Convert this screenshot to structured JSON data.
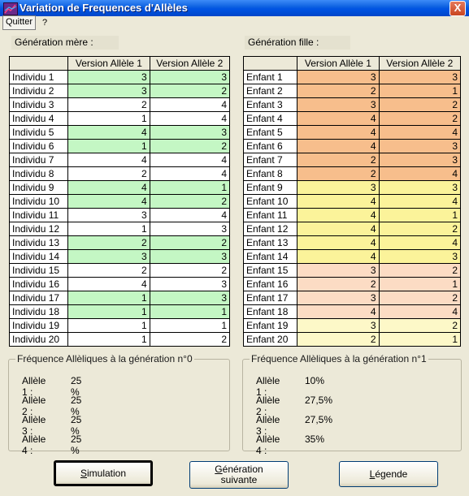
{
  "window": {
    "title": "Variation de Frequences d'Allèles",
    "close_glyph": "X"
  },
  "menu": {
    "quit_label": "Quitter",
    "help_label": "?"
  },
  "parents": {
    "label": "Génération mère :",
    "col1": "Version Allèle 1",
    "col2": "Version Allèle 2",
    "rows": [
      {
        "name": "Individu 1",
        "a1": "3",
        "a2": "3",
        "hl": true
      },
      {
        "name": "Individu 2",
        "a1": "3",
        "a2": "2",
        "hl": true
      },
      {
        "name": "Individu 3",
        "a1": "2",
        "a2": "4",
        "hl": false
      },
      {
        "name": "Individu 4",
        "a1": "1",
        "a2": "4",
        "hl": false
      },
      {
        "name": "Individu 5",
        "a1": "4",
        "a2": "3",
        "hl": true
      },
      {
        "name": "Individu 6",
        "a1": "1",
        "a2": "2",
        "hl": true
      },
      {
        "name": "Individu 7",
        "a1": "4",
        "a2": "4",
        "hl": false
      },
      {
        "name": "Individu 8",
        "a1": "2",
        "a2": "4",
        "hl": false
      },
      {
        "name": "Individu 9",
        "a1": "4",
        "a2": "1",
        "hl": true
      },
      {
        "name": "Individu 10",
        "a1": "4",
        "a2": "2",
        "hl": true
      },
      {
        "name": "Individu 11",
        "a1": "3",
        "a2": "4",
        "hl": false
      },
      {
        "name": "Individu 12",
        "a1": "1",
        "a2": "3",
        "hl": false
      },
      {
        "name": "Individu 13",
        "a1": "2",
        "a2": "2",
        "hl": true
      },
      {
        "name": "Individu 14",
        "a1": "3",
        "a2": "3",
        "hl": true
      },
      {
        "name": "Individu 15",
        "a1": "2",
        "a2": "2",
        "hl": false
      },
      {
        "name": "Individu 16",
        "a1": "4",
        "a2": "3",
        "hl": false
      },
      {
        "name": "Individu 17",
        "a1": "1",
        "a2": "3",
        "hl": true
      },
      {
        "name": "Individu 18",
        "a1": "1",
        "a2": "1",
        "hl": true
      },
      {
        "name": "Individu 19",
        "a1": "1",
        "a2": "1",
        "hl": false
      },
      {
        "name": "Individu 20",
        "a1": "1",
        "a2": "2",
        "hl": false
      }
    ]
  },
  "children": {
    "label": "Génération fille :",
    "col1": "Version Allèle 1",
    "col2": "Version Allèle 2",
    "rows": [
      {
        "name": "Enfant  1",
        "a1": "3",
        "a2": "3",
        "color": "#f7be8c"
      },
      {
        "name": "Enfant  2",
        "a1": "2",
        "a2": "1",
        "color": "#f7be8c"
      },
      {
        "name": "Enfant  3",
        "a1": "3",
        "a2": "2",
        "color": "#f7be8c"
      },
      {
        "name": "Enfant  4",
        "a1": "4",
        "a2": "2",
        "color": "#f7be8c"
      },
      {
        "name": "Enfant  5",
        "a1": "4",
        "a2": "4",
        "color": "#f7be8c"
      },
      {
        "name": "Enfant  6",
        "a1": "4",
        "a2": "3",
        "color": "#f7be8c"
      },
      {
        "name": "Enfant  7",
        "a1": "2",
        "a2": "3",
        "color": "#f7be8c"
      },
      {
        "name": "Enfant  8",
        "a1": "2",
        "a2": "4",
        "color": "#f7be8c"
      },
      {
        "name": "Enfant  9",
        "a1": "3",
        "a2": "3",
        "color": "#fbf39a"
      },
      {
        "name": "Enfant  10",
        "a1": "4",
        "a2": "4",
        "color": "#fbf39a"
      },
      {
        "name": "Enfant  11",
        "a1": "4",
        "a2": "1",
        "color": "#fbf39a"
      },
      {
        "name": "Enfant  12",
        "a1": "4",
        "a2": "2",
        "color": "#fbf39a"
      },
      {
        "name": "Enfant  13",
        "a1": "4",
        "a2": "4",
        "color": "#fbf39a"
      },
      {
        "name": "Enfant  14",
        "a1": "4",
        "a2": "3",
        "color": "#fbf39a"
      },
      {
        "name": "Enfant  15",
        "a1": "3",
        "a2": "2",
        "color": "#fcdcc4"
      },
      {
        "name": "Enfant  16",
        "a1": "2",
        "a2": "1",
        "color": "#fcdcc4"
      },
      {
        "name": "Enfant  17",
        "a1": "3",
        "a2": "2",
        "color": "#fcdcc4"
      },
      {
        "name": "Enfant  18",
        "a1": "4",
        "a2": "4",
        "color": "#fcdcc4"
      },
      {
        "name": "Enfant  19",
        "a1": "3",
        "a2": "2",
        "color": "#fdf8c8"
      },
      {
        "name": "Enfant  20",
        "a1": "2",
        "a2": "1",
        "color": "#fdf8c8"
      }
    ]
  },
  "freq0": {
    "title": "Fréquence Allèliques à la génération n°0",
    "rows": [
      {
        "label": "Allèle 1 :",
        "value": "25 %"
      },
      {
        "label": "Allèle 2 :",
        "value": "25 %"
      },
      {
        "label": "Allèle 3 :",
        "value": "25 %"
      },
      {
        "label": "Allèle 4 :",
        "value": "25 %"
      }
    ]
  },
  "freq1": {
    "title": "Fréquence Allèliques à la génération n°1",
    "rows": [
      {
        "label": "Allèle 1 :",
        "value": "10%"
      },
      {
        "label": "Allèle 2 :",
        "value": "27,5%"
      },
      {
        "label": "Allèle 3 :",
        "value": "27,5%"
      },
      {
        "label": "Allèle 4 :",
        "value": "35%"
      }
    ]
  },
  "buttons": {
    "simulation": {
      "first": "S",
      "rest": "imulation"
    },
    "next": {
      "first": "G",
      "rest": "énération",
      "line2": "suivante"
    },
    "legend": {
      "first": "L",
      "rest": "égende"
    }
  },
  "colors": {
    "green": "#c4f7c4",
    "white": "#ffffff"
  }
}
